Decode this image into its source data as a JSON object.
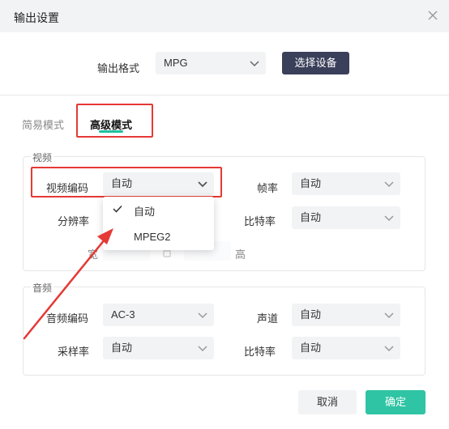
{
  "dialog": {
    "title": "输出设置"
  },
  "output": {
    "format_label": "输出格式",
    "format_value": "MPG",
    "select_device_label": "选择设备"
  },
  "tabs": [
    {
      "label": "简易模式",
      "active": false
    },
    {
      "label": "高级模式",
      "active": true
    }
  ],
  "video": {
    "group_title": "视频",
    "codec_label": "视频编码",
    "codec_value": "自动",
    "codec_options": [
      {
        "label": "自动",
        "selected": true
      },
      {
        "label": "MPEG2",
        "selected": false
      }
    ],
    "framerate_label": "帧率",
    "framerate_value": "自动",
    "resolution_label": "分辨率",
    "bitrate_label": "比特率",
    "bitrate_value": "自动",
    "width_label": "宽",
    "height_label": "高"
  },
  "audio": {
    "group_title": "音频",
    "codec_label": "音频编码",
    "codec_value": "AC-3",
    "channel_label": "声道",
    "channel_value": "自动",
    "samplerate_label": "采样率",
    "samplerate_value": "自动",
    "bitrate_label": "比特率",
    "bitrate_value": "自动"
  },
  "footer": {
    "cancel_label": "取消",
    "ok_label": "确定"
  },
  "colors": {
    "accent": "#2fc4a4",
    "annotation": "#e53935",
    "device_button": "#3a3f5a"
  }
}
